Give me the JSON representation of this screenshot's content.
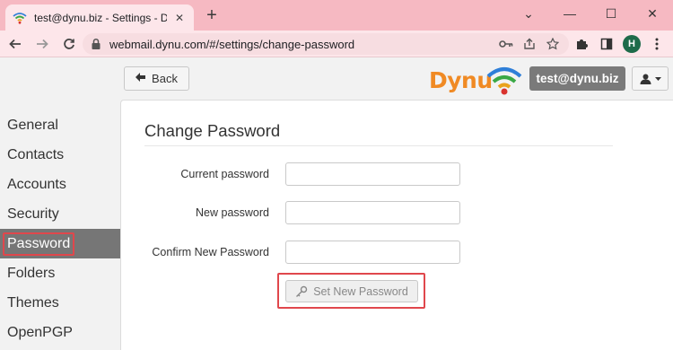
{
  "browser": {
    "tab_title": "test@dynu.biz - Settings - Dynu",
    "tab_close": "✕",
    "new_tab": "+",
    "window_controls": [
      "⌄",
      "—",
      "☐",
      "✕"
    ],
    "url": "webmail.dynu.com/#/settings/change-password",
    "profile_initial": "H"
  },
  "header": {
    "back_label": "Back",
    "brand": "Dynu",
    "user_email": "test@dynu.biz"
  },
  "sidebar": {
    "items": [
      {
        "label": "General"
      },
      {
        "label": "Contacts"
      },
      {
        "label": "Accounts"
      },
      {
        "label": "Security"
      },
      {
        "label": "Password",
        "active": true
      },
      {
        "label": "Folders"
      },
      {
        "label": "Themes"
      },
      {
        "label": "OpenPGP"
      }
    ]
  },
  "form": {
    "title": "Change Password",
    "fields": [
      {
        "label": "Current password",
        "value": ""
      },
      {
        "label": "New password",
        "value": ""
      },
      {
        "label": "Confirm New Password",
        "value": ""
      }
    ],
    "submit_label": "Set New Password"
  },
  "colors": {
    "tab_strip": "#f6b9c2",
    "toolbar": "#fde6ea",
    "brand_orange": "#f08a24",
    "active_item": "#767676",
    "highlight_red": "#e0474c"
  }
}
